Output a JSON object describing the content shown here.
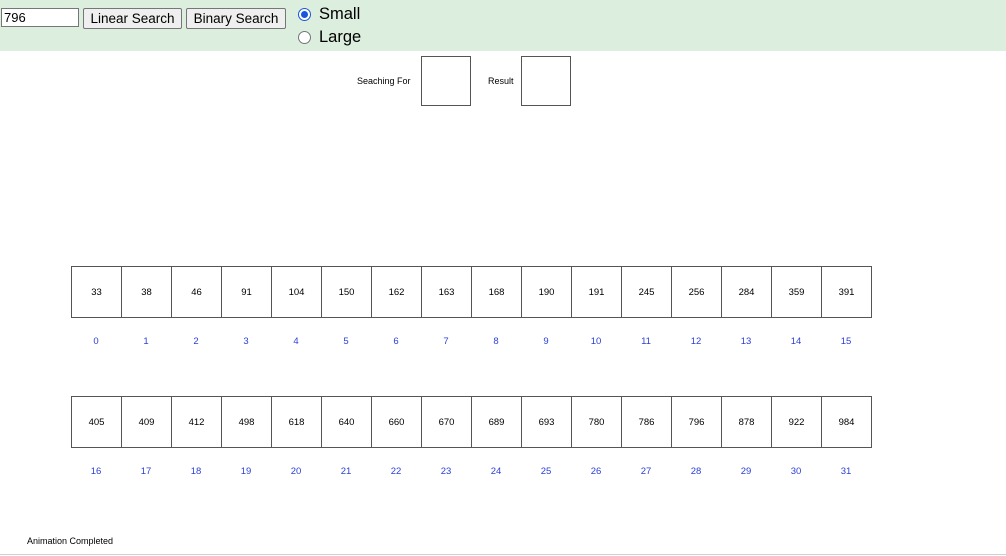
{
  "controls": {
    "search_value": "796",
    "linear_label": "Linear Search",
    "binary_label": "Binary Search",
    "size_options": [
      {
        "label": "Small",
        "checked": true
      },
      {
        "label": "Large",
        "checked": false
      }
    ]
  },
  "display": {
    "searching_label": "Seaching For",
    "searching_value": "",
    "result_label": "Result",
    "result_value": ""
  },
  "array": {
    "row1": {
      "values": [
        "33",
        "38",
        "46",
        "91",
        "104",
        "150",
        "162",
        "163",
        "168",
        "190",
        "191",
        "245",
        "256",
        "284",
        "359",
        "391"
      ],
      "indices": [
        "0",
        "1",
        "2",
        "3",
        "4",
        "5",
        "6",
        "7",
        "8",
        "9",
        "10",
        "11",
        "12",
        "13",
        "14",
        "15"
      ]
    },
    "row2": {
      "values": [
        "405",
        "409",
        "412",
        "498",
        "618",
        "640",
        "660",
        "670",
        "689",
        "693",
        "780",
        "786",
        "796",
        "878",
        "922",
        "984"
      ],
      "indices": [
        "16",
        "17",
        "18",
        "19",
        "20",
        "21",
        "22",
        "23",
        "24",
        "25",
        "26",
        "27",
        "28",
        "29",
        "30",
        "31"
      ]
    }
  },
  "status": "Animation Completed",
  "colors": {
    "topbar_bg": "#dcefdf",
    "index_text": "#2b3fd6",
    "radio_accent": "#1a56db"
  }
}
